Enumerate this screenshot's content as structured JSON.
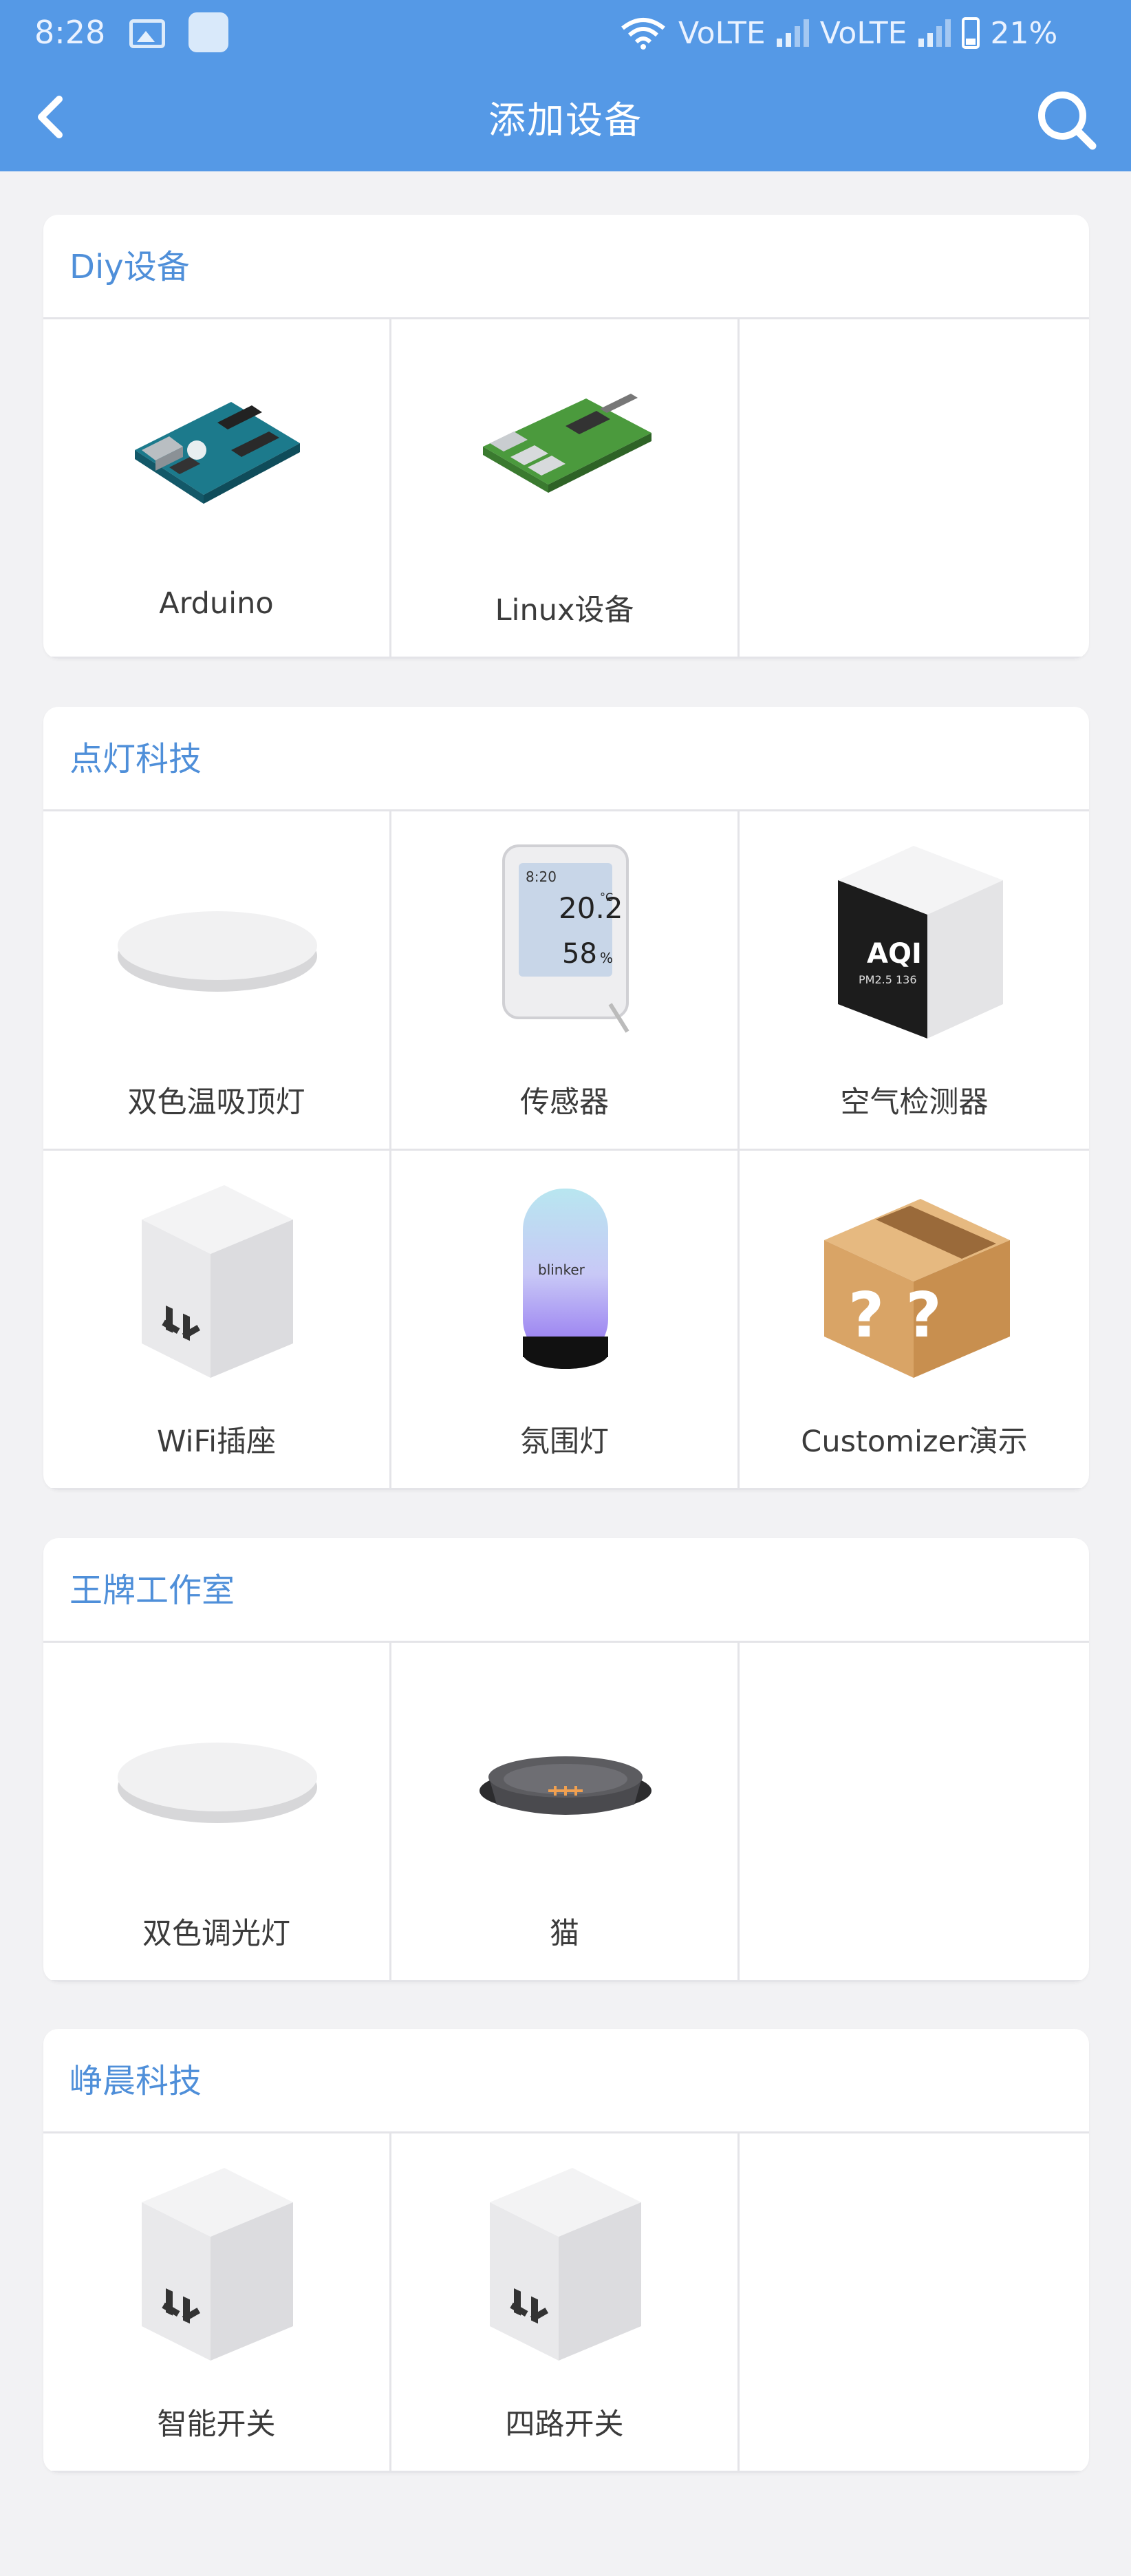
{
  "status_bar": {
    "time": "8:28",
    "battery": "21%",
    "network_1": "VoLTE",
    "network_2": "VoLTE"
  },
  "nav": {
    "title": "添加设备",
    "back_icon": "chevron-left-icon",
    "search_icon": "search-icon"
  },
  "sections": [
    {
      "title": "Diy设备",
      "items": [
        {
          "label": "Arduino"
        },
        {
          "label": "Linux设备"
        }
      ]
    },
    {
      "title": "点灯科技",
      "items": [
        {
          "label": "双色温吸顶灯"
        },
        {
          "label": "传感器"
        },
        {
          "label": "空气检测器"
        },
        {
          "label": "WiFi插座"
        },
        {
          "label": "氛围灯"
        },
        {
          "label": "Customizer演示"
        }
      ]
    },
    {
      "title": "王牌工作室",
      "items": [
        {
          "label": "双色调光灯"
        },
        {
          "label": "猫"
        }
      ]
    },
    {
      "title": "峥晨科技",
      "items": [
        {
          "label": "智能开关"
        },
        {
          "label": "四路开关"
        }
      ]
    }
  ],
  "device_texts": {
    "sensor_time": "8:20",
    "sensor_temp": "20.2",
    "sensor_temp_unit": "°C",
    "sensor_humidity": "58",
    "sensor_humidity_unit": "%",
    "aqi_title": "AQI",
    "aqi_line": "PM2.5 136",
    "lamp_brand": "blinker",
    "box_marks": "? ?"
  },
  "colors": {
    "header": "#5599e6",
    "section_title": "#4f8fd9",
    "background": "#f2f2f4"
  }
}
